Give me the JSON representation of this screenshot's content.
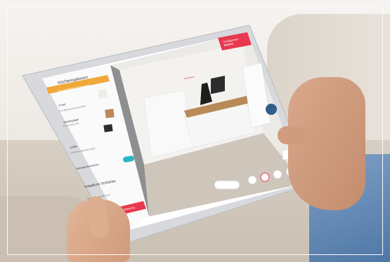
{
  "top_badge": {
    "line1": "Konfigurator",
    "line2": "Kaufen"
  },
  "panel": {
    "title": "Küchenoptionen",
    "banner": "Beispiel Standard-Küchenliste",
    "front_label": "Front",
    "front_value": "FG1 Bauhaus/Laminat Weiß",
    "worktop_label": "Arbeitsplatte",
    "worktop_value": "Eiche Sierra Hell",
    "handles_label": "Griffe",
    "handles_value": "Griffleiste (Edelstahl-Optik)",
    "toggle_label": "Wandabschlussleiste",
    "section_title": "Installierte Schränke",
    "row_label": "Hängeschrank (60 cm)",
    "row_price": "€",
    "cta": "Zusammenfassung"
  },
  "scene_label": "Wandfarbe",
  "toolbar_icons": [
    "view-icon",
    "undo-icon",
    "measure-icon",
    "delete-icon",
    "copy-icon"
  ],
  "colors": {
    "accent": "#e8384f",
    "toggle": "#2bb5c4",
    "panel_bg": "#ffffff"
  }
}
